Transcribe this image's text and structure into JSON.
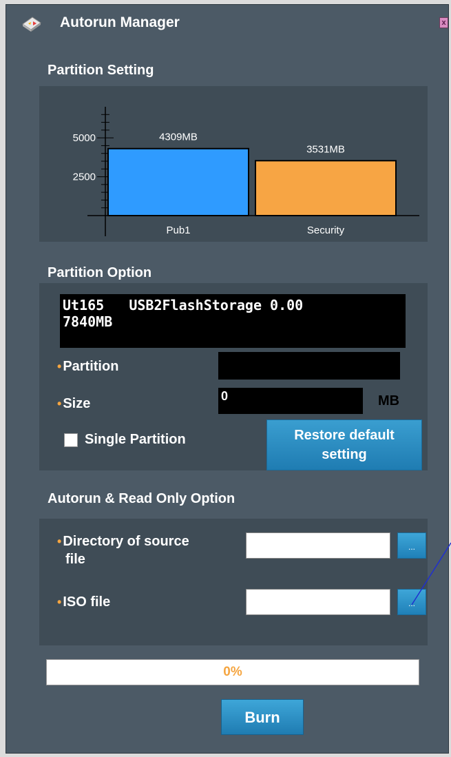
{
  "window": {
    "title": "Autorun Manager",
    "close_glyph": "x"
  },
  "partition_setting": {
    "title": "Partition Setting",
    "chart_data": {
      "type": "bar",
      "categories": [
        "Pub1",
        "Security"
      ],
      "values": [
        4309,
        3531
      ],
      "data_labels": [
        "4309MB",
        "3531MB"
      ],
      "y_ticks": [
        2500,
        5000
      ],
      "y_tick_labels": [
        "2500",
        "5000"
      ],
      "colors": [
        "#2f9bff",
        "#f7a544"
      ],
      "ylim": [
        0,
        7000
      ]
    }
  },
  "partition_option": {
    "title": "Partition Option",
    "device_line1": "Ut165   USB2FlashStorage 0.00",
    "device_line2": "7840MB",
    "partition_label": "Partition",
    "partition_value": "",
    "size_label": "Size",
    "size_value": "0",
    "size_unit": "MB",
    "single_partition_label": "Single Partition",
    "single_partition_checked": false,
    "restore_line1": "Restore default",
    "restore_line2": "setting"
  },
  "autorun": {
    "title": "Autorun & Read Only Option",
    "source_dir_label_line1": "Directory of source",
    "source_dir_label_line2": "file",
    "source_dir_value": "",
    "iso_label": "ISO file",
    "iso_value": "",
    "browse_label": "..."
  },
  "progress": {
    "percent": 0,
    "text": "0%"
  },
  "burn_label": "Burn",
  "colors": {
    "accent": "#f5a540",
    "button": "#2a8fc6",
    "background": "#4c5a66"
  }
}
